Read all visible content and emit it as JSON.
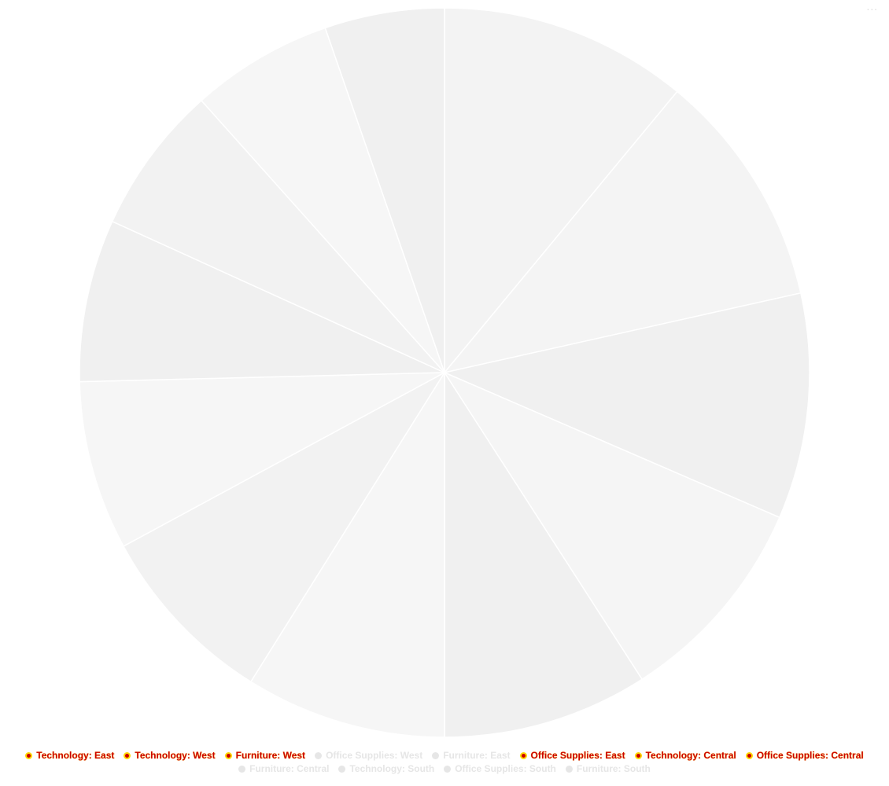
{
  "menu": {
    "label": "..."
  },
  "colors": {
    "slice_stroke": "#ffffff",
    "legend_active": "#cc0000",
    "legend_outline": "#ffd700",
    "legend_faded": "#e6e6e6"
  },
  "chart_data": {
    "type": "pie",
    "title": "",
    "start_angle_deg": 0,
    "slices": [
      {
        "label": "Technology: East",
        "value": 11.0,
        "color": "#f3f3f3",
        "legend_style": "active"
      },
      {
        "label": "Technology: West",
        "value": 10.5,
        "color": "#f4f4f4",
        "legend_style": "active"
      },
      {
        "label": "Furniture: West",
        "value": 10.0,
        "color": "#f0f0f0",
        "legend_style": "active"
      },
      {
        "label": "Office Supplies: West",
        "value": 9.4,
        "color": "#f5f5f5",
        "legend_style": "faded"
      },
      {
        "label": "Furniture: East",
        "value": 9.1,
        "color": "#f0f0f0",
        "legend_style": "faded"
      },
      {
        "label": "Office Supplies: East",
        "value": 8.9,
        "color": "#f6f6f6",
        "legend_style": "active"
      },
      {
        "label": "Technology: Central",
        "value": 8.2,
        "color": "#f2f2f2",
        "legend_style": "active"
      },
      {
        "label": "Office Supplies: Central",
        "value": 7.5,
        "color": "#f6f6f6",
        "legend_style": "active"
      },
      {
        "label": "Furniture: Central",
        "value": 7.2,
        "color": "#f0f0f0",
        "legend_style": "faded"
      },
      {
        "label": "Technology: South",
        "value": 6.6,
        "color": "#f2f2f2",
        "legend_style": "faded"
      },
      {
        "label": "Office Supplies: South",
        "value": 6.3,
        "color": "#f6f6f6",
        "legend_style": "faded"
      },
      {
        "label": "Furniture: South",
        "value": 5.3,
        "color": "#f0f0f0",
        "legend_style": "faded"
      }
    ],
    "legend_position": "bottom"
  }
}
